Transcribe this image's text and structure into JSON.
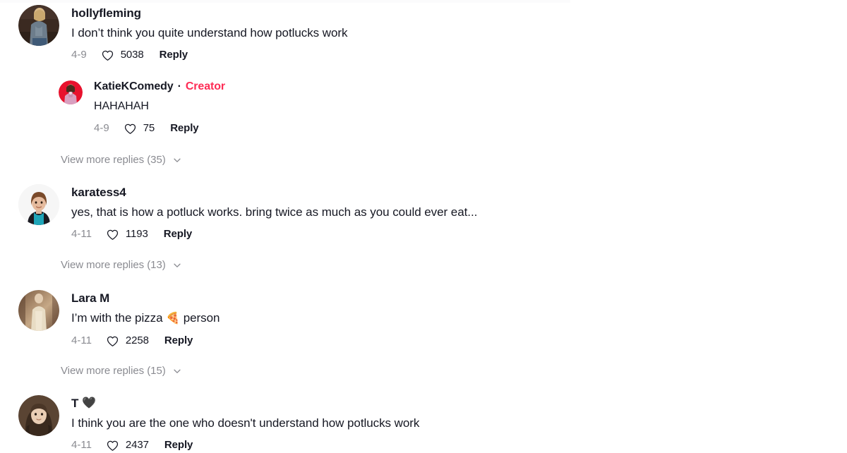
{
  "app": {
    "platform": "tiktok-comments"
  },
  "colors": {
    "text_primary": "#161823",
    "text_muted": "#8a8b91",
    "creator_accent": "#fe2c55",
    "background": "#ffffff"
  },
  "icons": {
    "heart": "heart-outline-icon",
    "chevron": "chevron-down-icon"
  },
  "labels": {
    "reply": "Reply",
    "creator": "Creator",
    "separator": "·"
  },
  "comments": [
    {
      "id": "c1",
      "username": "hollyfleming",
      "username_emoji": "",
      "text": "I don’t think you quite understand how potlucks work",
      "date": "4-9",
      "likes": "5038",
      "reply_label": "Reply",
      "is_creator": false,
      "avatar": "avatar-hollyfleming",
      "replies": [
        {
          "id": "c1r1",
          "username": "KatieKComedy",
          "text": "HAHAHAH",
          "date": "4-9",
          "likes": "75",
          "reply_label": "Reply",
          "is_creator": true,
          "creator_label": "Creator",
          "avatar": "avatar-katiekcomedy"
        }
      ],
      "view_more": "View more replies (35)"
    },
    {
      "id": "c2",
      "username": "karatess4",
      "username_emoji": "",
      "text": "yes, that is how a potluck works. bring twice as much as you could ever eat...",
      "date": "4-11",
      "likes": "1193",
      "reply_label": "Reply",
      "is_creator": false,
      "avatar": "avatar-karatess4",
      "replies": [],
      "view_more": "View more replies (13)"
    },
    {
      "id": "c3",
      "username": "Lara M",
      "username_emoji": "",
      "text_before_emoji": "I’m with the pizza ",
      "text_emoji": "🍕",
      "text_after_emoji": " person",
      "text": "I’m with the pizza 🍕 person",
      "date": "4-11",
      "likes": "2258",
      "reply_label": "Reply",
      "is_creator": false,
      "avatar": "avatar-lara-m",
      "replies": [],
      "view_more": "View more replies (15)"
    },
    {
      "id": "c4",
      "username": "T",
      "username_emoji": "🖤",
      "text": "I think you are the one who doesn't understand how potlucks work",
      "date": "4-11",
      "likes": "2437",
      "reply_label": "Reply",
      "is_creator": false,
      "avatar": "avatar-t",
      "replies": [],
      "view_more": ""
    }
  ]
}
